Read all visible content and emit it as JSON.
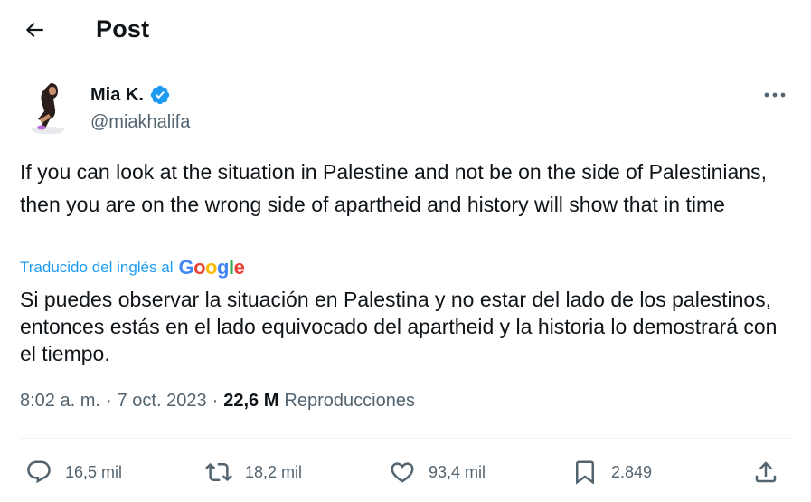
{
  "header": {
    "title": "Post"
  },
  "author": {
    "name": "Mia K.",
    "handle": "@miakhalifa"
  },
  "tweet": {
    "text": "If you can look at the situation in Palestine and not be on the side of Palestinians, then you are on the wrong side of apartheid and history will show that in time",
    "translated_label": "Traducido del inglés al",
    "translation": "Si puedes observar la situación en Palestina y no estar del lado de los palestinos, entonces estás en el lado equivocado del apartheid y la historia lo demostrará con el tiempo."
  },
  "meta": {
    "time": "8:02 a. m.",
    "separator": "·",
    "date": "7 oct. 2023",
    "views_count": "22,6 M",
    "views_label": "Reproducciones"
  },
  "actions": {
    "replies": "16,5 mil",
    "reposts": "18,2 mil",
    "likes": "93,4 mil",
    "bookmarks": "2.849"
  },
  "colors": {
    "accent": "#1d9bf0",
    "muted": "#536471",
    "text": "#0f1419",
    "divider": "#eff3f4"
  },
  "icons": [
    "back-arrow-icon",
    "verified-badge-icon",
    "more-options-icon",
    "google-logo",
    "reply-icon",
    "repost-icon",
    "like-icon",
    "bookmark-icon",
    "share-icon"
  ]
}
